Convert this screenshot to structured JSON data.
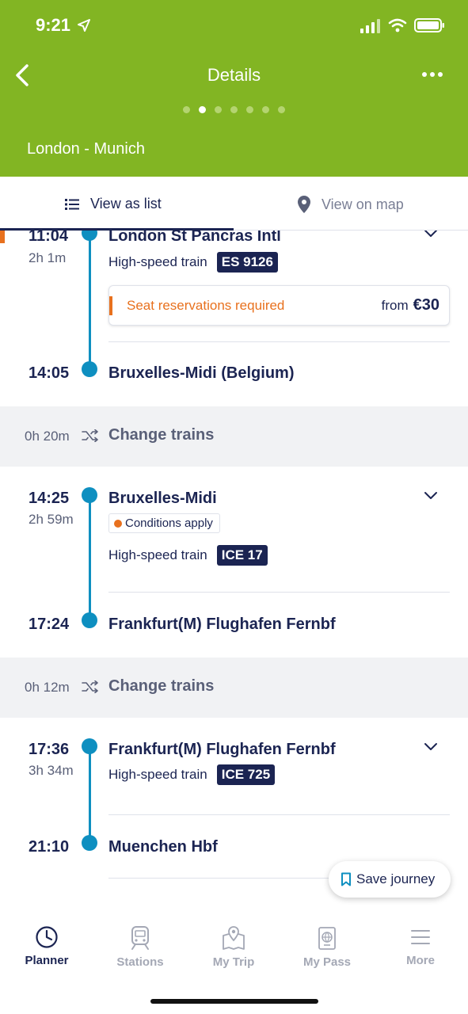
{
  "status_bar": {
    "time": "9:21"
  },
  "header": {
    "title": "Details",
    "route": "London - Munich",
    "page_count": 7,
    "active_page": 2
  },
  "tabs": {
    "list": "View as list",
    "map": "View on map"
  },
  "legs": [
    {
      "dep_time": "11:04",
      "duration": "2h 1m",
      "dep_station": "London St Pancras Intl",
      "train_type": "High-speed train",
      "train_number": "ES 9126",
      "reservation": {
        "text": "Seat reservations required",
        "from": "from",
        "price": "€30"
      },
      "arr_time": "14:05",
      "arr_station": "Bruxelles-Midi (Belgium)"
    },
    {
      "dep_time": "14:25",
      "duration": "2h 59m",
      "dep_station": "Bruxelles-Midi",
      "conditions": "Conditions apply",
      "train_type": "High-speed train",
      "train_number": "ICE 17",
      "arr_time": "17:24",
      "arr_station": "Frankfurt(M) Flughafen Fernbf"
    },
    {
      "dep_time": "17:36",
      "duration": "3h 34m",
      "dep_station": "Frankfurt(M) Flughafen Fernbf",
      "train_type": "High-speed train",
      "train_number": "ICE 725",
      "arr_time": "21:10",
      "arr_station": "Muenchen Hbf"
    }
  ],
  "changes": [
    {
      "duration": "0h 20m",
      "label": "Change trains"
    },
    {
      "duration": "0h 12m",
      "label": "Change trains"
    }
  ],
  "save_button": "Save journey",
  "bottom_nav": [
    {
      "label": "Planner",
      "icon": "clock-icon",
      "active": true
    },
    {
      "label": "Stations",
      "icon": "train-icon",
      "active": false
    },
    {
      "label": "My Trip",
      "icon": "map-pin-icon",
      "active": false
    },
    {
      "label": "My Pass",
      "icon": "passport-icon",
      "active": false
    },
    {
      "label": "More",
      "icon": "menu-icon",
      "active": false
    }
  ],
  "colors": {
    "brand_green": "#82b523",
    "navy": "#1b2452",
    "line_blue": "#0e8fc0",
    "warning_orange": "#e8711e"
  }
}
